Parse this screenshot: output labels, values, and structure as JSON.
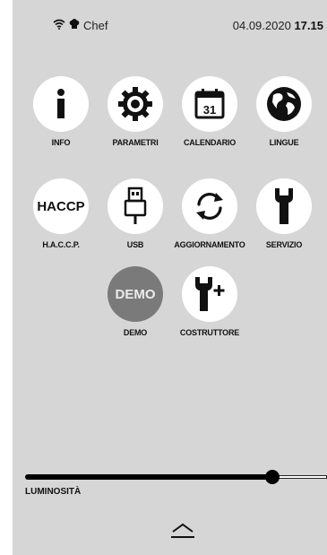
{
  "status": {
    "wifi_icon": "wifi-icon",
    "user_icon": "chef-hat-icon",
    "user": "Chef",
    "date": "04.09.2020",
    "time": "17.15"
  },
  "menu": [
    {
      "id": "info",
      "label": "INFO",
      "icon": "info-icon"
    },
    {
      "id": "parametri",
      "label": "PARAMETRI",
      "icon": "gear-icon"
    },
    {
      "id": "calendario",
      "label": "CALENDARIO",
      "icon": "calendar-icon",
      "icon_text": "31"
    },
    {
      "id": "lingue",
      "label": "LINGUE",
      "icon": "globe-icon"
    },
    {
      "id": "haccp",
      "label": "H.A.C.C.P.",
      "icon": "haccp-text",
      "icon_text": "HACCP"
    },
    {
      "id": "usb",
      "label": "USB",
      "icon": "usb-icon"
    },
    {
      "id": "aggiornamento",
      "label": "AGGIORNAMENTO",
      "icon": "refresh-icon"
    },
    {
      "id": "servizio",
      "label": "SERVIZIO",
      "icon": "wrench-icon"
    },
    {
      "id": "demo",
      "label": "DEMO",
      "icon": "demo-text",
      "icon_text": "DEMO"
    },
    {
      "id": "costruttore",
      "label": "COSTRUTTORE",
      "icon": "wrench-plus-icon"
    }
  ],
  "brightness": {
    "label": "LUMINOSITÀ",
    "value": 0.82
  },
  "footer": {
    "eject_icon": "eject-icon"
  },
  "colors": {
    "background": "#d6d6d6",
    "tile": "#ffffff",
    "demo_tile": "#7a7a7a",
    "text": "#111111"
  }
}
